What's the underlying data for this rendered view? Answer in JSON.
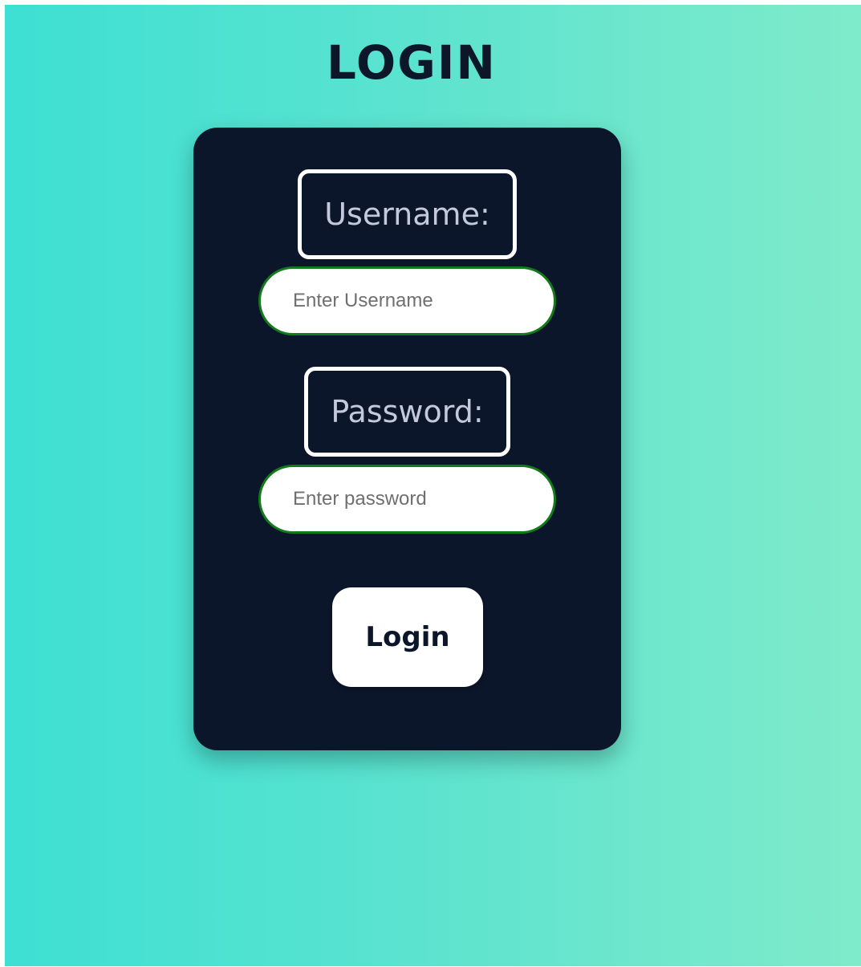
{
  "page": {
    "title": "LOGIN"
  },
  "form": {
    "username_label": "Username:",
    "username_placeholder": "Enter Username",
    "username_value": "",
    "password_label": "Password:",
    "password_placeholder": "Enter password",
    "password_value": "",
    "login_label": "Login"
  },
  "colors": {
    "background_start": "#3de0d3",
    "background_end": "#7febca",
    "card": "#0c162a",
    "input_border": "#137a1c",
    "label_text": "#c4c9dc"
  }
}
